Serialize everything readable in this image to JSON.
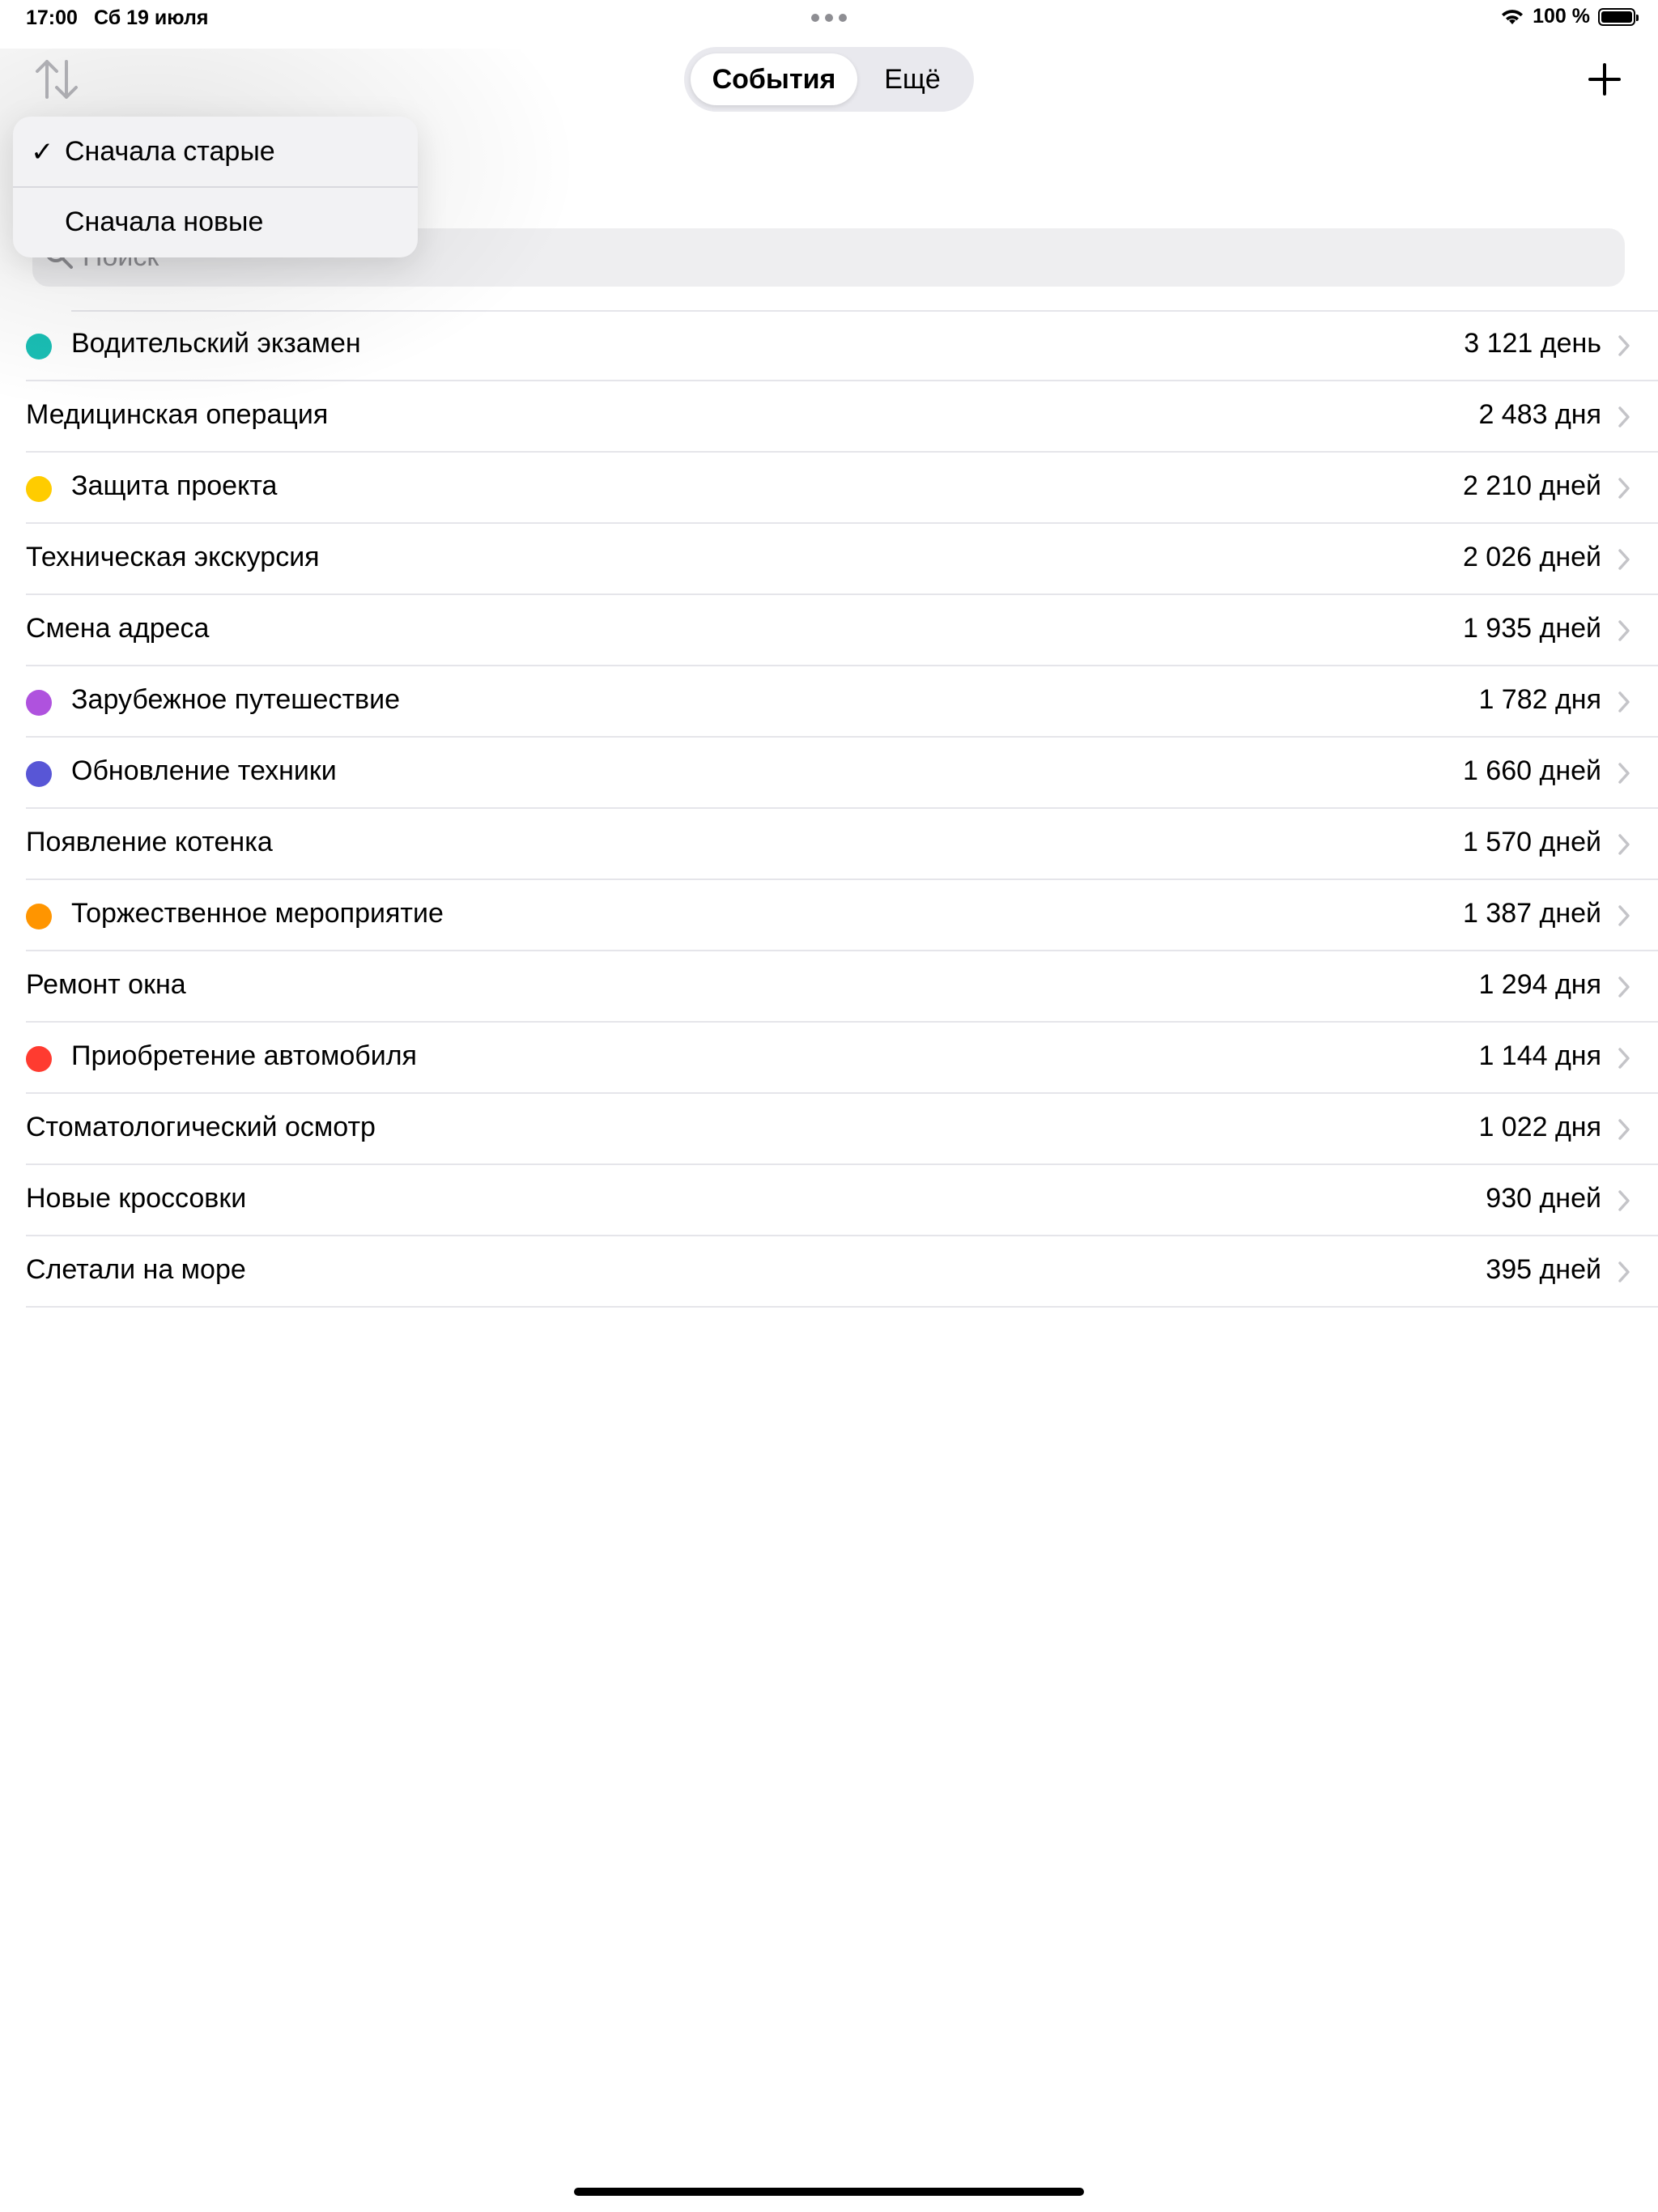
{
  "status_bar": {
    "time": "17:00",
    "date": "Сб 19 июля",
    "battery_percent": "100 %",
    "battery_level": 1.0
  },
  "nav": {
    "segments": [
      "События",
      "Ещё"
    ],
    "selected_segment": "События",
    "sort_icon": "sort-arrows-icon",
    "add_icon": "plus-icon"
  },
  "sort_menu": {
    "options": [
      {
        "label": "Сначала старые",
        "checked": true
      },
      {
        "label": "Сначала новые",
        "checked": false
      }
    ]
  },
  "search": {
    "placeholder": "Поиск"
  },
  "events": [
    {
      "name": "Водительский экзамен",
      "value": "3 121 день",
      "color": "#1ABFB5"
    },
    {
      "name": "Медицинская операция",
      "value": "2 483 дня",
      "color": null
    },
    {
      "name": "Защита проекта",
      "value": "2 210 дней",
      "color": "#FFCC00"
    },
    {
      "name": "Техническая экскурсия",
      "value": "2 026 дней",
      "color": null
    },
    {
      "name": "Смена адреса",
      "value": "1 935 дней",
      "color": null
    },
    {
      "name": "Зарубежное путешествие",
      "value": "1 782 дня",
      "color": "#AF52DE"
    },
    {
      "name": "Обновление техники",
      "value": "1 660 дней",
      "color": "#5856D6"
    },
    {
      "name": "Появление котенка",
      "value": "1 570 дней",
      "color": null
    },
    {
      "name": "Торжественное мероприятие",
      "value": "1 387 дней",
      "color": "#FF9500"
    },
    {
      "name": "Ремонт окна",
      "value": "1 294 дня",
      "color": null
    },
    {
      "name": "Приобретение автомобиля",
      "value": "1 144 дня",
      "color": "#FF3B30"
    },
    {
      "name": "Стоматологический осмотр",
      "value": "1 022 дня",
      "color": null
    },
    {
      "name": "Новые кроссовки",
      "value": "930 дней",
      "color": null
    },
    {
      "name": "Слетали на море",
      "value": "395 дней",
      "color": null
    }
  ]
}
